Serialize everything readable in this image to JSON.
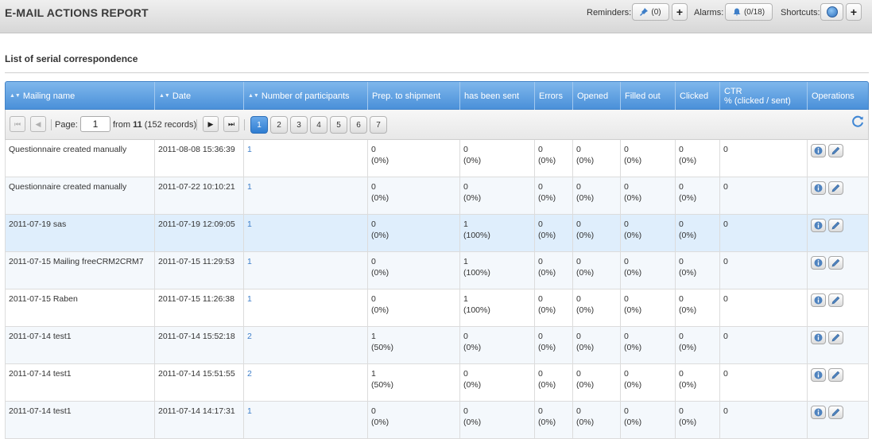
{
  "header": {
    "title": "E-MAIL ACTIONS REPORT",
    "reminders_label": "Reminders:",
    "reminders_count": "(0)",
    "alarms_label": "Alarms:",
    "alarms_count": "(0/18)",
    "shortcuts_label": "Shortcuts:",
    "plus": "+"
  },
  "section": {
    "title": "List of serial correspondence"
  },
  "columns": [
    "Mailing name",
    "Date",
    "Number of participants",
    "Prep. to shipment",
    "has been sent",
    "Errors",
    "Opened",
    "Filled out",
    "Clicked",
    "CTR % (clicked / sent)",
    "Operations"
  ],
  "ctr_header": {
    "line1": "CTR",
    "line2": "% (clicked / sent)"
  },
  "pager": {
    "page_label": "Page:",
    "page_value": "1",
    "from_prefix": "from",
    "total_pages": "11",
    "records": "(152 records)",
    "pages": [
      "1",
      "2",
      "3",
      "4",
      "5",
      "6",
      "7"
    ],
    "active_page": "1"
  },
  "rows": [
    {
      "name": "Questionnaire created manually",
      "date": "2011-08-08 15:36:39",
      "participants": "1",
      "prep": "0",
      "prep_pct": "(0%)",
      "sent": "0",
      "sent_pct": "(0%)",
      "errors": "0",
      "errors_pct": "(0%)",
      "opened": "0",
      "opened_pct": "(0%)",
      "filled": "0",
      "filled_pct": "(0%)",
      "clicked": "0",
      "clicked_pct": "(0%)",
      "ctr": "0"
    },
    {
      "name": "Questionnaire created manually",
      "date": "2011-07-22 10:10:21",
      "participants": "1",
      "prep": "0",
      "prep_pct": "(0%)",
      "sent": "0",
      "sent_pct": "(0%)",
      "errors": "0",
      "errors_pct": "(0%)",
      "opened": "0",
      "opened_pct": "(0%)",
      "filled": "0",
      "filled_pct": "(0%)",
      "clicked": "0",
      "clicked_pct": "(0%)",
      "ctr": "0"
    },
    {
      "name": "2011-07-19 sas",
      "date": "2011-07-19 12:09:05",
      "participants": "1",
      "prep": "0",
      "prep_pct": "(0%)",
      "sent": "1",
      "sent_pct": "(100%)",
      "errors": "0",
      "errors_pct": "(0%)",
      "opened": "0",
      "opened_pct": "(0%)",
      "filled": "0",
      "filled_pct": "(0%)",
      "clicked": "0",
      "clicked_pct": "(0%)",
      "ctr": "0"
    },
    {
      "name": "2011-07-15 Mailing freeCRM2CRM7",
      "date": "2011-07-15 11:29:53",
      "participants": "1",
      "prep": "0",
      "prep_pct": "(0%)",
      "sent": "1",
      "sent_pct": "(100%)",
      "errors": "0",
      "errors_pct": "(0%)",
      "opened": "0",
      "opened_pct": "(0%)",
      "filled": "0",
      "filled_pct": "(0%)",
      "clicked": "0",
      "clicked_pct": "(0%)",
      "ctr": "0"
    },
    {
      "name": "2011-07-15 Raben",
      "date": "2011-07-15 11:26:38",
      "participants": "1",
      "prep": "0",
      "prep_pct": "(0%)",
      "sent": "1",
      "sent_pct": "(100%)",
      "errors": "0",
      "errors_pct": "(0%)",
      "opened": "0",
      "opened_pct": "(0%)",
      "filled": "0",
      "filled_pct": "(0%)",
      "clicked": "0",
      "clicked_pct": "(0%)",
      "ctr": "0"
    },
    {
      "name": "2011-07-14 test1",
      "date": "2011-07-14 15:52:18",
      "participants": "2",
      "prep": "1",
      "prep_pct": "(50%)",
      "sent": "0",
      "sent_pct": "(0%)",
      "errors": "0",
      "errors_pct": "(0%)",
      "opened": "0",
      "opened_pct": "(0%)",
      "filled": "0",
      "filled_pct": "(0%)",
      "clicked": "0",
      "clicked_pct": "(0%)",
      "ctr": "0"
    },
    {
      "name": "2011-07-14 test1",
      "date": "2011-07-14 15:51:55",
      "participants": "2",
      "prep": "1",
      "prep_pct": "(50%)",
      "sent": "0",
      "sent_pct": "(0%)",
      "errors": "0",
      "errors_pct": "(0%)",
      "opened": "0",
      "opened_pct": "(0%)",
      "filled": "0",
      "filled_pct": "(0%)",
      "clicked": "0",
      "clicked_pct": "(0%)",
      "ctr": "0"
    },
    {
      "name": "2011-07-14 test1",
      "date": "2011-07-14 14:17:31",
      "participants": "1",
      "prep": "0",
      "prep_pct": "(0%)",
      "sent": "0",
      "sent_pct": "(0%)",
      "errors": "0",
      "errors_pct": "(0%)",
      "opened": "0",
      "opened_pct": "(0%)",
      "filled": "0",
      "filled_pct": "(0%)",
      "clicked": "0",
      "clicked_pct": "(0%)",
      "ctr": "0"
    }
  ],
  "highlighted_row": 2,
  "colors": {
    "accent": "#4a90d9",
    "link": "#3d7ec9",
    "row_highlight": "#dfeefc"
  }
}
